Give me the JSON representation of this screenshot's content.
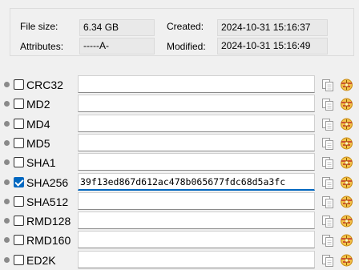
{
  "file_info": {
    "file_size_label": "File size:",
    "file_size_value": "6.34 GB",
    "attributes_label": "Attributes:",
    "attributes_value": "-----A-",
    "created_label": "Created:",
    "created_value": "2024-10-31 15:16:37",
    "modified_label": "Modified:",
    "modified_value": "2024-10-31 15:16:49"
  },
  "hashes": [
    {
      "name": "CRC32",
      "checked": false,
      "value": ""
    },
    {
      "name": "MD2",
      "checked": false,
      "value": ""
    },
    {
      "name": "MD4",
      "checked": false,
      "value": ""
    },
    {
      "name": "MD5",
      "checked": false,
      "value": ""
    },
    {
      "name": "SHA1",
      "checked": false,
      "value": ""
    },
    {
      "name": "SHA256",
      "checked": true,
      "value": "39f13ed867d612ac478b065677fdc68d5a3fc"
    },
    {
      "name": "SHA512",
      "checked": false,
      "value": ""
    },
    {
      "name": "RMD128",
      "checked": false,
      "value": ""
    },
    {
      "name": "RMD160",
      "checked": false,
      "value": ""
    },
    {
      "name": "ED2K",
      "checked": false,
      "value": ""
    }
  ],
  "icons": {
    "status": "status-dot-icon",
    "copy": "copy-icon",
    "verify": "compare-icon"
  }
}
